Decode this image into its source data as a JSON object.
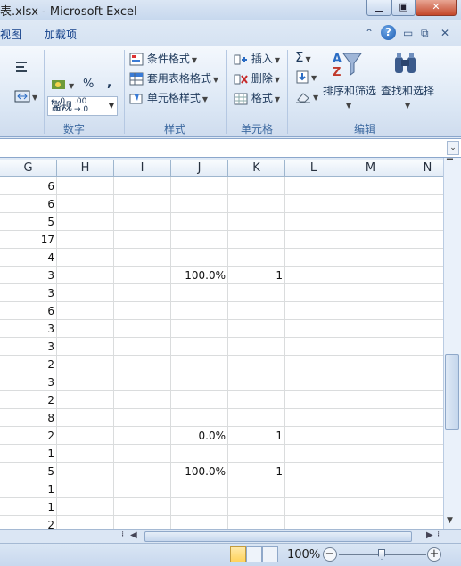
{
  "window": {
    "title": "表.xlsx - Microsoft Excel"
  },
  "menu": {
    "tabs": [
      "视图",
      "加载项"
    ]
  },
  "ribbon": {
    "number": {
      "format": "常规",
      "percent": "%",
      "comma": ",",
      "inc_decimal": "←.0 .00",
      "dec_decimal": ".00 →.0",
      "label": "数字"
    },
    "styles": {
      "conditional": "条件格式",
      "table": "套用表格格式",
      "cell": "单元格样式",
      "label": "样式"
    },
    "cells": {
      "insert": "插入",
      "delete": "删除",
      "format": "格式",
      "label": "单元格"
    },
    "editing": {
      "sigma": "Σ",
      "sort_filter": "排序和筛选",
      "find_select": "查找和选择",
      "label": "编辑"
    }
  },
  "grid": {
    "columns": [
      "G",
      "H",
      "I",
      "J",
      "K",
      "L",
      "M",
      "N"
    ],
    "rows": [
      {
        "G": "6"
      },
      {
        "G": "6"
      },
      {
        "G": "5"
      },
      {
        "G": "17"
      },
      {
        "G": "4"
      },
      {
        "G": "3",
        "J": "100.0%",
        "K": "1"
      },
      {
        "G": "3"
      },
      {
        "G": "6"
      },
      {
        "G": "3"
      },
      {
        "G": "3"
      },
      {
        "G": "2"
      },
      {
        "G": "3"
      },
      {
        "G": "2"
      },
      {
        "G": "8"
      },
      {
        "G": "2",
        "J": "0.0%",
        "K": "1"
      },
      {
        "G": "1"
      },
      {
        "G": "5",
        "J": "100.0%",
        "K": "1"
      },
      {
        "G": "1"
      },
      {
        "G": "1"
      },
      {
        "G": "2"
      }
    ]
  },
  "status": {
    "zoom": "100%"
  }
}
